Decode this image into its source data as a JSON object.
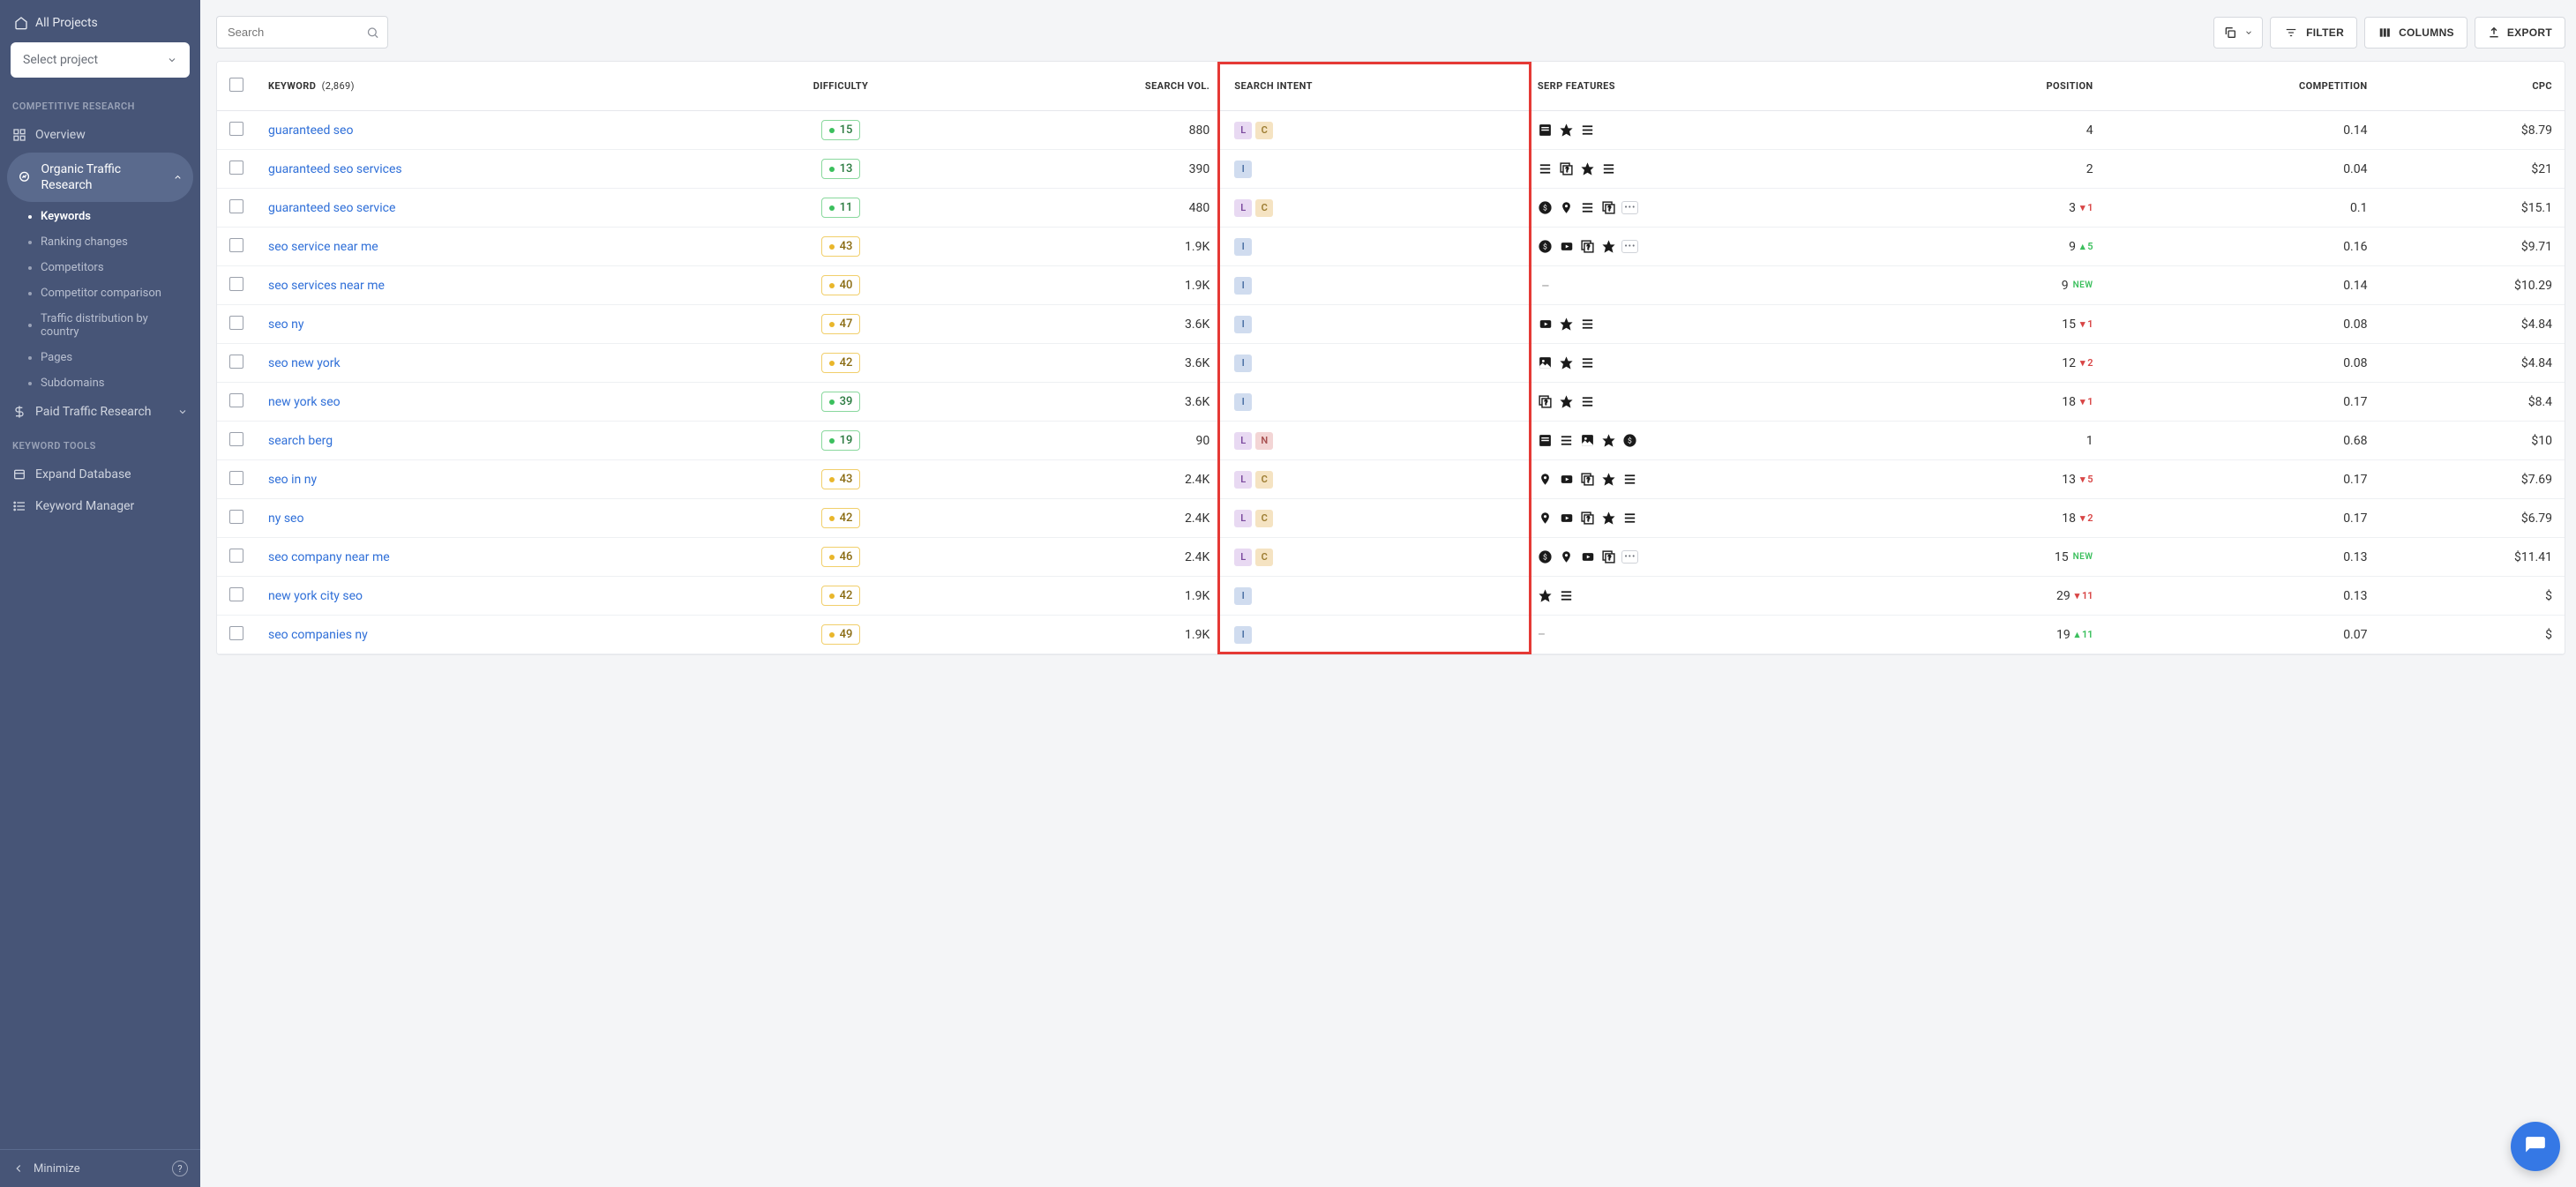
{
  "sidebar": {
    "all_projects": "All Projects",
    "select_project": "Select project",
    "section1": "COMPETITIVE RESEARCH",
    "overview": "Overview",
    "organic": "Organic Traffic Research",
    "subs": [
      "Keywords",
      "Ranking changes",
      "Competitors",
      "Competitor comparison",
      "Traffic distribution by country",
      "Pages",
      "Subdomains"
    ],
    "paid": "Paid Traffic Research",
    "section2": "KEYWORD TOOLS",
    "expand_db": "Expand Database",
    "keyword_mgr": "Keyword Manager",
    "minimize": "Minimize"
  },
  "toolbar": {
    "search_placeholder": "Search",
    "filter": "FILTER",
    "columns": "COLUMNS",
    "export": "EXPORT"
  },
  "table": {
    "headers": {
      "keyword": "KEYWORD",
      "keyword_count": "(2,869)",
      "difficulty": "DIFFICULTY",
      "search_vol": "SEARCH VOL.",
      "search_intent": "SEARCH INTENT",
      "serp_features": "SERP FEATURES",
      "position": "POSITION",
      "competition": "COMPETITION",
      "cpc": "CPC"
    },
    "rows": [
      {
        "kw": "guaranteed seo",
        "diff": 15,
        "diffColor": "green",
        "vol": "880",
        "intent": [
          "L",
          "C"
        ],
        "serp": [
          "localpack",
          "star",
          "list"
        ],
        "pos": "4",
        "delta": null,
        "comp": "0.14",
        "cpc": "$8.79"
      },
      {
        "kw": "guaranteed seo services",
        "diff": 13,
        "diffColor": "green",
        "vol": "390",
        "intent": [
          "I"
        ],
        "serp": [
          "list",
          "faq",
          "star",
          "list"
        ],
        "pos": "2",
        "delta": null,
        "comp": "0.04",
        "cpc": "$21"
      },
      {
        "kw": "guaranteed seo service",
        "diff": 11,
        "diffColor": "green",
        "vol": "480",
        "intent": [
          "L",
          "C"
        ],
        "serp": [
          "dollar",
          "pin",
          "list",
          "faq",
          "more"
        ],
        "pos": "3",
        "delta": {
          "dir": "down",
          "v": "1"
        },
        "comp": "0.1",
        "cpc": "$15.1"
      },
      {
        "kw": "seo service near me",
        "diff": 43,
        "diffColor": "yellow",
        "vol": "1.9K",
        "intent": [
          "I"
        ],
        "serp": [
          "dollar",
          "video",
          "faq",
          "star",
          "more"
        ],
        "pos": "9",
        "delta": {
          "dir": "up",
          "v": "5"
        },
        "comp": "0.16",
        "cpc": "$9.71"
      },
      {
        "kw": "seo services near me",
        "diff": 40,
        "diffColor": "yellow",
        "vol": "1.9K",
        "intent": [
          "I"
        ],
        "serp": [
          "dash"
        ],
        "pos": "9",
        "delta": {
          "dir": "new",
          "v": "NEW"
        },
        "comp": "0.14",
        "cpc": "$10.29"
      },
      {
        "kw": "seo ny",
        "diff": 47,
        "diffColor": "yellow",
        "vol": "3.6K",
        "intent": [
          "I"
        ],
        "serp": [
          "video",
          "star",
          "list"
        ],
        "pos": "15",
        "delta": {
          "dir": "down",
          "v": "1"
        },
        "comp": "0.08",
        "cpc": "$4.84"
      },
      {
        "kw": "seo new york",
        "diff": 42,
        "diffColor": "yellow",
        "vol": "3.6K",
        "intent": [
          "I"
        ],
        "serp": [
          "image",
          "star",
          "list"
        ],
        "pos": "12",
        "delta": {
          "dir": "down",
          "v": "2"
        },
        "comp": "0.08",
        "cpc": "$4.84"
      },
      {
        "kw": "new york seo",
        "diff": 39,
        "diffColor": "green",
        "vol": "3.6K",
        "intent": [
          "I"
        ],
        "serp": [
          "faq",
          "star",
          "list"
        ],
        "pos": "18",
        "delta": {
          "dir": "down",
          "v": "1"
        },
        "comp": "0.17",
        "cpc": "$8.4"
      },
      {
        "kw": "search berg",
        "diff": 19,
        "diffColor": "green",
        "vol": "90",
        "intent": [
          "L",
          "N"
        ],
        "serp": [
          "localpack",
          "list",
          "image",
          "star",
          "dollar"
        ],
        "pos": "1",
        "delta": null,
        "comp": "0.68",
        "cpc": "$10"
      },
      {
        "kw": "seo in ny",
        "diff": 43,
        "diffColor": "yellow",
        "vol": "2.4K",
        "intent": [
          "L",
          "C"
        ],
        "serp": [
          "pin",
          "video",
          "faq",
          "star",
          "list"
        ],
        "pos": "13",
        "delta": {
          "dir": "down",
          "v": "5"
        },
        "comp": "0.17",
        "cpc": "$7.69"
      },
      {
        "kw": "ny seo",
        "diff": 42,
        "diffColor": "yellow",
        "vol": "2.4K",
        "intent": [
          "L",
          "C"
        ],
        "serp": [
          "pin",
          "video",
          "faq",
          "star",
          "list"
        ],
        "pos": "18",
        "delta": {
          "dir": "down",
          "v": "2"
        },
        "comp": "0.17",
        "cpc": "$6.79"
      },
      {
        "kw": "seo company near me",
        "diff": 46,
        "diffColor": "yellow",
        "vol": "2.4K",
        "intent": [
          "L",
          "C"
        ],
        "serp": [
          "dollar",
          "pin",
          "video",
          "faq",
          "more"
        ],
        "pos": "15",
        "delta": {
          "dir": "new",
          "v": "NEW"
        },
        "comp": "0.13",
        "cpc": "$11.41"
      },
      {
        "kw": "new york city seo",
        "diff": 42,
        "diffColor": "yellow",
        "vol": "1.9K",
        "intent": [
          "I"
        ],
        "serp": [
          "star",
          "list"
        ],
        "pos": "29",
        "delta": {
          "dir": "down",
          "v": "11"
        },
        "comp": "0.13",
        "cpc": "$"
      },
      {
        "kw": "seo companies ny",
        "diff": 49,
        "diffColor": "yellow",
        "vol": "1.9K",
        "intent": [
          "I"
        ],
        "serp": [],
        "pos": "19",
        "delta": {
          "dir": "up",
          "v": "11"
        },
        "comp": "0.07",
        "cpc": "$"
      }
    ]
  }
}
